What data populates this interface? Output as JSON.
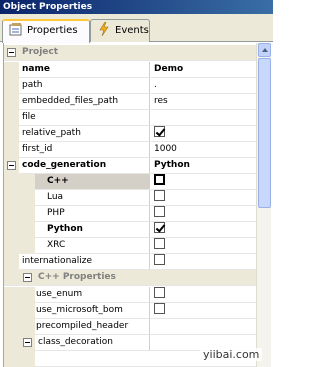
{
  "window": {
    "title": "Object Properties"
  },
  "tabs": [
    {
      "label": "Properties",
      "icon": "properties-icon",
      "active": true
    },
    {
      "label": "Events",
      "icon": "lightning-icon",
      "active": false
    }
  ],
  "grid": {
    "project_category": "Project",
    "rows": [
      {
        "name": "name",
        "value": "Demo",
        "bold": true
      },
      {
        "name": "path",
        "value": "."
      },
      {
        "name": "embedded_files_path",
        "value": "res"
      },
      {
        "name": "file",
        "value": ""
      },
      {
        "name": "relative_path",
        "checked": true
      },
      {
        "name": "first_id",
        "value": "1000"
      },
      {
        "name": "code_generation",
        "value": "Python",
        "bold": true
      },
      {
        "name": "C++",
        "checked": false,
        "bold": true,
        "selected": true
      },
      {
        "name": "Lua",
        "checked": false
      },
      {
        "name": "PHP",
        "checked": false
      },
      {
        "name": "Python",
        "checked": true,
        "bold": true
      },
      {
        "name": "XRC",
        "checked": false
      },
      {
        "name": "internationalize",
        "checked": false
      }
    ],
    "cpp_category": "C++ Properties",
    "cpp_rows": [
      {
        "name": "use_enum",
        "checked": false
      },
      {
        "name": "use_microsoft_bom",
        "checked": false
      },
      {
        "name": "precompiled_header",
        "value": ""
      },
      {
        "name": "class_decoration",
        "value": ""
      }
    ]
  },
  "watermark": "yiibai.com",
  "colors": {
    "titlebar": "#0a246a",
    "tab_highlight": "#ffc83c",
    "margin": "#ece9d8"
  }
}
